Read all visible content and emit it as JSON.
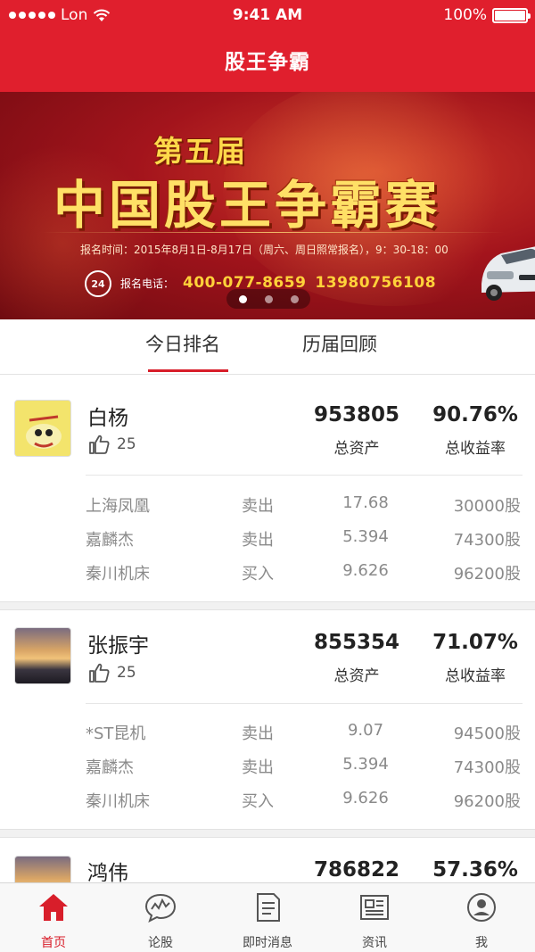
{
  "status_bar": {
    "carrier": "Lon",
    "time": "9:41 AM",
    "battery": "100%"
  },
  "nav": {
    "title": "股王争霸"
  },
  "banner": {
    "edition": "第五届",
    "title": "中国股王争霸赛",
    "registration_time": "报名时间：2015年8月1日-8月17日（周六、周日照常报名），9：30-18：00",
    "badge": "24",
    "phone_label": "报名电话：",
    "phone1": "400-077-8659",
    "phone2": "13980756108",
    "page_count": 3,
    "active_page": 1
  },
  "tabs": [
    {
      "label": "今日排名",
      "active": true
    },
    {
      "label": "历届回顾",
      "active": false
    }
  ],
  "players": [
    {
      "name": "白杨",
      "likes": "25",
      "assets": "953805",
      "assets_label": "总资产",
      "return_rate": "90.76%",
      "return_label": "总收益率",
      "trades": [
        {
          "stock": "上海凤凰",
          "action": "卖出",
          "price": "17.68",
          "qty": "30000股"
        },
        {
          "stock": "嘉麟杰",
          "action": "卖出",
          "price": "5.394",
          "qty": "74300股"
        },
        {
          "stock": "秦川机床",
          "action": "买入",
          "price": "9.626",
          "qty": "96200股"
        }
      ]
    },
    {
      "name": "张振宇",
      "likes": "25",
      "assets": "855354",
      "assets_label": "总资产",
      "return_rate": "71.07%",
      "return_label": "总收益率",
      "trades": [
        {
          "stock": "*ST昆机",
          "action": "卖出",
          "price": "9.07",
          "qty": "94500股"
        },
        {
          "stock": "嘉麟杰",
          "action": "卖出",
          "price": "5.394",
          "qty": "74300股"
        },
        {
          "stock": "秦川机床",
          "action": "买入",
          "price": "9.626",
          "qty": "96200股"
        }
      ]
    },
    {
      "name": "鸿伟",
      "assets": "786822",
      "return_rate": "57.36%"
    }
  ],
  "tabbar": [
    {
      "label": "首页",
      "icon": "home-icon",
      "active": true
    },
    {
      "label": "论股",
      "icon": "chat-chart-icon",
      "active": false
    },
    {
      "label": "即时消息",
      "icon": "document-icon",
      "active": false
    },
    {
      "label": "资讯",
      "icon": "newspaper-icon",
      "active": false
    },
    {
      "label": "我",
      "icon": "user-icon",
      "active": false
    }
  ],
  "colors": {
    "brand": "#e01f2d",
    "accent": "#d81e2a",
    "banner_gold": "#ffe066"
  }
}
